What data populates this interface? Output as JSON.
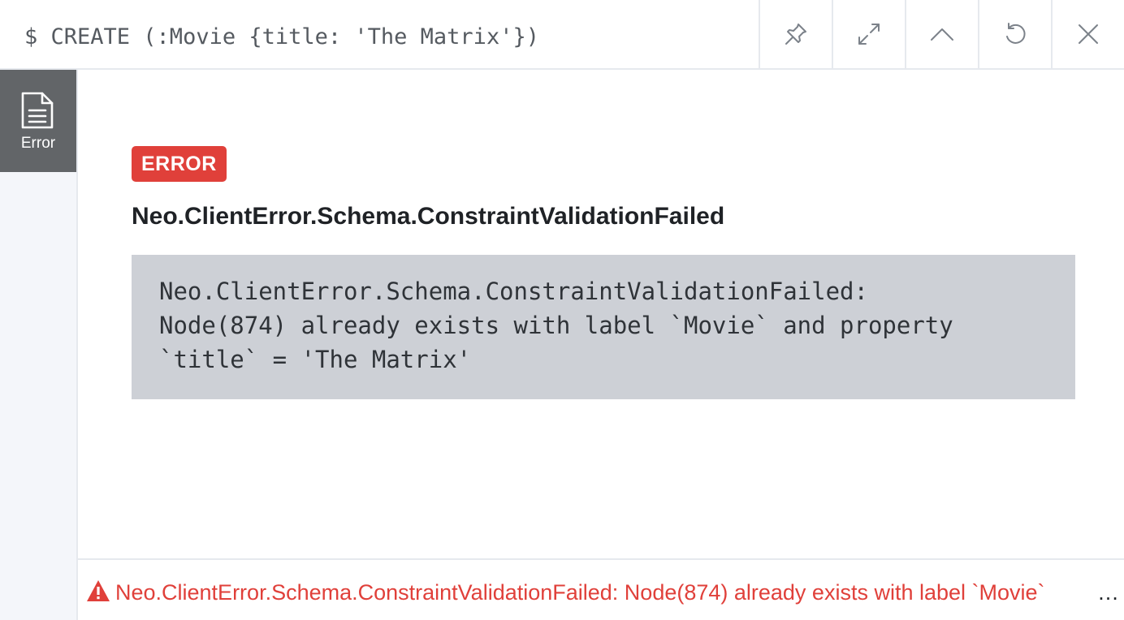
{
  "header": {
    "command": "$ CREATE (:Movie {title: 'The Matrix'})",
    "actions": [
      {
        "name": "pin-icon"
      },
      {
        "name": "fullscreen-icon"
      },
      {
        "name": "collapse-icon"
      },
      {
        "name": "rerun-icon"
      },
      {
        "name": "close-icon"
      }
    ]
  },
  "sidebar": {
    "tabs": [
      {
        "label": "Error",
        "icon": "document-icon",
        "active": true
      }
    ]
  },
  "main": {
    "badge": "ERROR",
    "error_code": "Neo.ClientError.Schema.ConstraintValidationFailed",
    "error_message": "Neo.ClientError.Schema.ConstraintValidationFailed:\nNode(874) already exists with label `Movie` and property\n`title` = 'The Matrix'"
  },
  "status": {
    "icon": "warning-icon",
    "text": "Neo.ClientError.Schema.ConstraintValidationFailed: Node(874) already exists with label `Movie`",
    "more": "…"
  },
  "colors": {
    "error": "#e0403a",
    "sidebar_active": "#626568",
    "message_box": "#cdd0d6"
  }
}
